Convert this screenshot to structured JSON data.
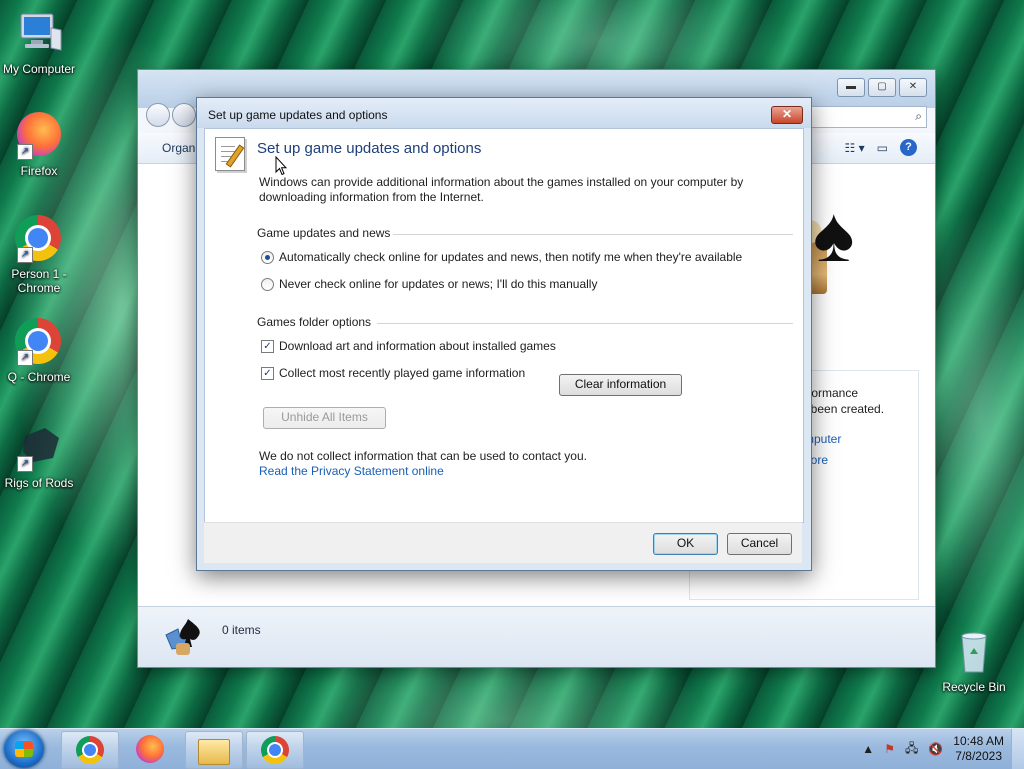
{
  "desktop": {
    "icons": [
      {
        "label": "My Computer",
        "icon": "computer-icon"
      },
      {
        "label": "Firefox",
        "icon": "firefox-icon"
      },
      {
        "label": "Person 1 - Chrome",
        "icon": "chrome-icon"
      },
      {
        "label": "Q - Chrome",
        "icon": "chrome-icon"
      },
      {
        "label": "Rigs of Rods",
        "icon": "rigs-of-rods-icon"
      },
      {
        "label": "Recycle Bin",
        "icon": "recycle-bin-icon"
      }
    ]
  },
  "explorer": {
    "toolbar": {
      "organize_label": "Organ"
    },
    "side_panel": {
      "text_line1": "rformance",
      "text_line2": "t been created.",
      "link1": "mputer",
      "link2": "nore"
    },
    "status": {
      "items_text": "0 items"
    }
  },
  "dialog": {
    "title": "Set up game updates and options",
    "heading": "Set up game updates and options",
    "intro": "Windows can provide additional information about the games installed on your computer by downloading information from the Internet.",
    "updates_section": {
      "title": "Game updates and news",
      "options": [
        {
          "label": "Automatically check online for updates and news, then notify me when they're available",
          "selected": true
        },
        {
          "label": "Never check online for updates or news; I'll do this manually",
          "selected": false
        }
      ]
    },
    "folder_section": {
      "title": "Games folder options",
      "checks": [
        {
          "label": "Download art and information about installed games",
          "checked": true
        },
        {
          "label": "Collect most recently played game information",
          "checked": true
        }
      ],
      "clear_button": "Clear information",
      "unhide_button": "Unhide All Items"
    },
    "privacy_note": "We do not collect information that can be used to contact you.",
    "privacy_link": "Read the Privacy Statement online",
    "ok_button": "OK",
    "cancel_button": "Cancel",
    "close_glyph": "✕"
  },
  "taskbar": {
    "clock_time": "10:48 AM",
    "clock_date": "7/8/2023"
  }
}
